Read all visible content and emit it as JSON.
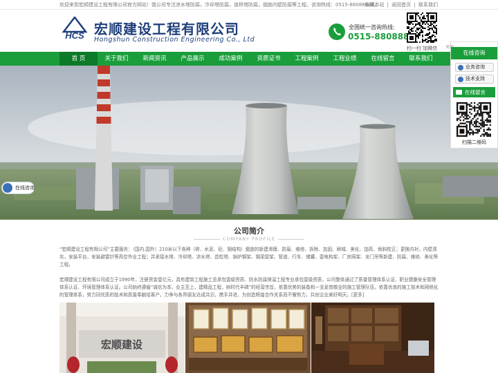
{
  "topbar": {
    "welcome": "欢迎来到宏顺建设工程有限公司官方网站！我公司专注凉水塔防腐，冷却塔防腐，道桥塔防腐，烟囱内壁防腐等工程。咨询热线：0515-88088888。",
    "links": [
      "收藏本站",
      "返回首页",
      "联系我们"
    ],
    "separator": "|"
  },
  "header": {
    "brand_cn": "宏顺建设工程有限公司",
    "brand_en": "Hongshun Construction Engineering Co., Ltd",
    "logo_icon": "hcs-logo-icon",
    "phone_icon": "phone-icon",
    "phone_label": "全国统一咨询热线:",
    "phone_number": "0515-88088888",
    "qr_caption": "扫一扫 加微信"
  },
  "nav": {
    "items": [
      "首 页",
      "关于我们",
      "新闻资讯",
      "产品展示",
      "成功案例",
      "资质证书",
      "工程案例",
      "工程业绩",
      "在线留言",
      "联系我们"
    ],
    "active_index": 0,
    "color": "#1a9e3c",
    "active_color": "#0d7a29"
  },
  "consult_float": {
    "label": "在线咨询"
  },
  "float_panel": {
    "close": "关闭",
    "title": "在线咨询",
    "buttons": [
      "业务咨询",
      "技术支持"
    ],
    "message": "在线留言",
    "qr_caption": "扫描二维码"
  },
  "about": {
    "title": "公司简介",
    "subtitle": "COMPANY PROFILE",
    "para1": "“宏顺建设工程有限公司”主要服务：（国内.国外）210米以下各种（砖、水泥、砼、钢结构）烟囱的新建滑模、防腐、维修、拆除、加固、刷域、美化、加高、倾斜校正；更换内衬，内壁清灰，安装平台，安装避雷针等高空作业工程；并承接水塔、冷却塔、凉水塔、造粒塔、锅炉钢架、钢梁屋架、管道、行车、储罐、壹电构架、厂房网架、龙门吊等新建、防腐、维修、美化等工程。",
    "para2": "宏顺建设工程有限公司成立于1990年，注册资金壹亿元，具有建筑工程施工总承包壹级资质、防水防腐保温工程专业承包壹级资质，公司整体通过了质量管理体系认证、职业健康安全管理体系认证、环境管理体系认证。公司始终遵循“诚信为本，业主至上，建精品工程，树时代丰碑”的经营宗旨，依靠优势的装备和一支爱岗敬业的施工管理队伍，依靠优良的施工技术和网络化的管理体系，努力同优质的技术和质量奉献给客户，力争与各界朋友达成共识，携手并进，为创造辉煌合作关系而不懈努力，共创企业美好明天。[更多]"
  },
  "photos": [
    {
      "icon": "lobby-photo",
      "sign": "宏顺建设"
    },
    {
      "icon": "certificates-photo",
      "sign": ""
    },
    {
      "icon": "office-photo",
      "sign": ""
    }
  ]
}
